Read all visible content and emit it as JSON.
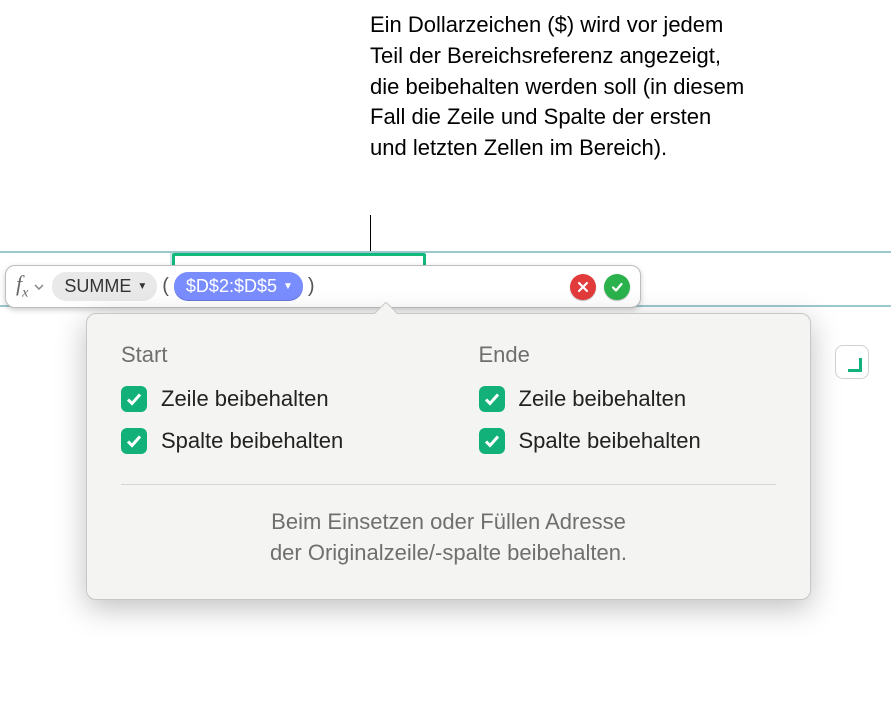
{
  "callout": {
    "text": "Ein Dollarzeichen ($) wird vor jedem Teil der Bereichsreferenz angezeigt, die beibehalten werden soll (in diesem Fall die Zeile und Spalte der ersten und letzten Zellen im Bereich)."
  },
  "formula_bar": {
    "fx_label": "f",
    "fx_sub": "x",
    "function_token": "SUMME",
    "open_paren": "(",
    "range_token": "$D$2:$D$5",
    "close_paren": ")"
  },
  "popover": {
    "start": {
      "heading": "Start",
      "preserve_row": {
        "label": "Zeile beibehalten",
        "checked": true
      },
      "preserve_col": {
        "label": "Spalte beibehalten",
        "checked": true
      }
    },
    "end": {
      "heading": "Ende",
      "preserve_row": {
        "label": "Zeile beibehalten",
        "checked": true
      },
      "preserve_col": {
        "label": "Spalte beibehalten",
        "checked": true
      }
    },
    "footer_line1": "Beim Einsetzen oder Füllen Adresse",
    "footer_line2": "der Originalzeile/-spalte beibehalten."
  },
  "icons": {
    "triangle_down": "▼"
  },
  "colors": {
    "accent_green": "#13b17a",
    "range_blue": "#7a8dff",
    "cancel_red": "#e23b3b",
    "accept_green": "#2bb24c"
  }
}
